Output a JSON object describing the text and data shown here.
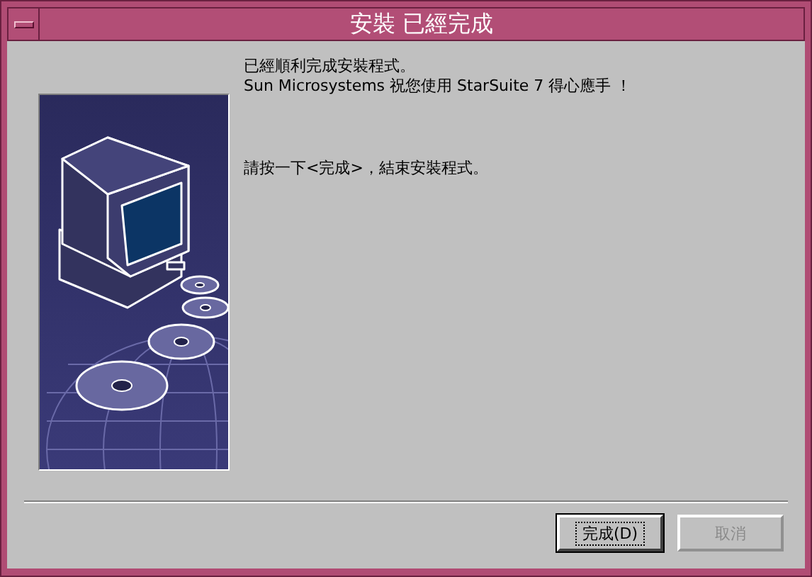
{
  "window": {
    "title": "安裝 已經完成"
  },
  "message": {
    "lines": [
      "已經順利完成安裝程式。",
      "Sun Microsystems 祝您使用 StarSuite 7 得心應手 ！"
    ],
    "instruction": "請按一下<完成>，結束安裝程式。"
  },
  "buttons": [
    {
      "label": "完成(D)",
      "disabled": false,
      "focused": true
    },
    {
      "label": "取消",
      "disabled": true,
      "focused": false
    }
  ]
}
